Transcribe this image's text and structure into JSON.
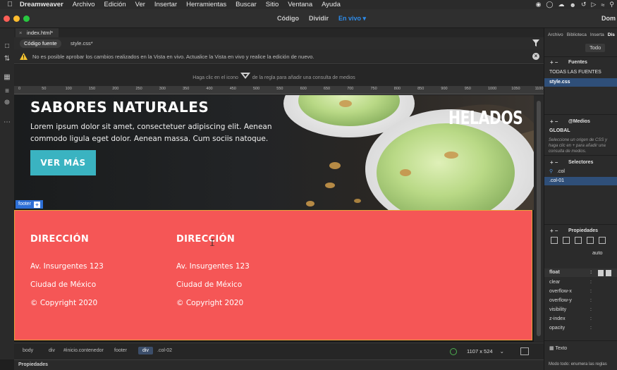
{
  "menubar": {
    "app": "Dreamweaver",
    "items": [
      "Archivo",
      "Edición",
      "Ver",
      "Insertar",
      "Herramientas",
      "Buscar",
      "Sitio",
      "Ventana",
      "Ayuda"
    ]
  },
  "titlebar": {
    "view_modes": [
      "Código",
      "Dividir",
      "En vivo"
    ],
    "active_mode": "En vivo",
    "workspace": "Dom"
  },
  "document": {
    "tab": "index.html*",
    "subtabs": [
      "Código fuente",
      "style.css*"
    ]
  },
  "warning": {
    "text": "No es posible aprobar los cambios realizados en la Vista en vivo. Actualice la Vista en vivo y realice la edición de nuevo."
  },
  "media_query_bar": {
    "before": "Haga clic en el icono",
    "after": "de la regla para añadir una consulta de medios"
  },
  "ruler": {
    "ticks": [
      "0",
      "50",
      "100",
      "150",
      "200",
      "250",
      "300",
      "350",
      "400",
      "450",
      "500",
      "550",
      "600",
      "650",
      "700",
      "750",
      "800",
      "850",
      "900",
      "950",
      "1000",
      "1050",
      "1100"
    ]
  },
  "hero": {
    "title": "SABORES NATURALES",
    "body": "Lorem ipsum dolor sit amet, consectetuer adipiscing elit. Aenean commodo ligula eget dolor. Aenean massa. Cum sociis natoque.",
    "button": "VER MÁS",
    "brand": "HELADOS"
  },
  "footer_tag": "footer",
  "footer": {
    "columns": [
      {
        "heading": "DIRECCIÓN",
        "lines": [
          "Av. Insurgentes 123",
          "Ciudad de México",
          "© Copyright 2020"
        ]
      },
      {
        "heading": "DIRECCIÓN",
        "lines": [
          "Av. Insurgentes 123",
          "Ciudad de México",
          "© Copyright 2020"
        ]
      }
    ]
  },
  "tagbar": {
    "crumbs": [
      "body",
      "div",
      "#inicio.contenedor",
      "footer",
      "div",
      ".col-02"
    ],
    "selected_index": 4,
    "size": "1107 x 524"
  },
  "statusbar": {
    "label": "Propiedades"
  },
  "right_panel": {
    "tabs": [
      "Archivo",
      "Biblioteca",
      "Inserta",
      "Dis"
    ],
    "active_tab": "Dis",
    "todo_button": "Todo",
    "fuentes": {
      "heading": "Fuentes",
      "items": [
        "TODAS LAS FUENTES",
        "style.css"
      ]
    },
    "medios": {
      "heading": "@Medios",
      "items": [
        "GLOBAL"
      ],
      "note": "Seleccione un origen de CSS y haga clic en + para añadir una consulta de medios."
    },
    "selectores": {
      "heading": "Selectores",
      "search": ".col",
      "items": [
        ".col-01"
      ]
    },
    "propiedades": {
      "heading": "Propiedades",
      "value": "auto",
      "rows": [
        "float",
        "clear",
        "overflow-x",
        "overflow-y",
        "visibility",
        "z-index",
        "opacity"
      ],
      "texto": "Texto",
      "footer_note": "Modo todo: enumera las reglas"
    }
  },
  "colors": {
    "accent_blue": "#2d8ceb",
    "footer_bg": "#f55656",
    "button_bg": "#3ab3c1",
    "selection_blue": "#2f4f79"
  }
}
